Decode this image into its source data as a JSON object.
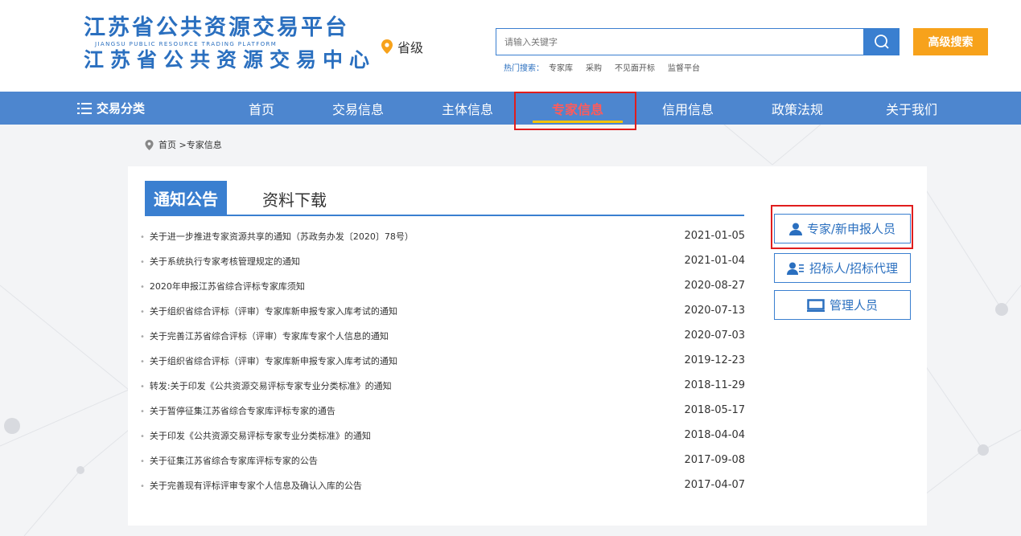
{
  "header": {
    "logo_line1": "江苏省公共资源交易平台",
    "logo_sub": "JIANGSU PUBLIC RESOURCE TRADING PLATFORM",
    "logo_line2": "江苏省公共资源交易中心",
    "region": "省级",
    "search": {
      "placeholder": "请输入关键字"
    },
    "advanced_search": "高级搜索",
    "hot_label": "热门搜索：",
    "hot_items": [
      "专家库",
      "采购",
      "不见面开标",
      "监督平台"
    ]
  },
  "nav": {
    "category": "交易分类",
    "items": [
      "首页",
      "交易信息",
      "主体信息",
      "专家信息",
      "信用信息",
      "政策法规",
      "关于我们"
    ],
    "active_index": 3
  },
  "breadcrumb": "首页 >专家信息",
  "tabs": {
    "active": "通知公告",
    "other": "资料下载"
  },
  "notices": [
    {
      "title": "关于进一步推进专家资源共享的通知（苏政务办发〔2020〕78号）",
      "date": "2021-01-05"
    },
    {
      "title": "关于系统执行专家考核管理规定的通知",
      "date": "2021-01-04"
    },
    {
      "title": "2020年申报江苏省综合评标专家库须知",
      "date": "2020-08-27"
    },
    {
      "title": "关于组织省综合评标（评审）专家库新申报专家入库考试的通知",
      "date": "2020-07-13"
    },
    {
      "title": "关于完善江苏省综合评标（评审）专家库专家个人信息的通知",
      "date": "2020-07-03"
    },
    {
      "title": "关于组织省综合评标（评审）专家库新申报专家入库考试的通知",
      "date": "2019-12-23"
    },
    {
      "title": "转发:关于印发《公共资源交易评标专家专业分类标准》的通知",
      "date": "2018-11-29"
    },
    {
      "title": "关于暂停征集江苏省综合专家库评标专家的通告",
      "date": "2018-05-17"
    },
    {
      "title": "关于印发《公共资源交易评标专家专业分类标准》的通知",
      "date": "2018-04-04"
    },
    {
      "title": "关于征集江苏省综合专家库评标专家的公告",
      "date": "2017-09-08"
    },
    {
      "title": "关于完善现有评标评审专家个人信息及确认入库的公告",
      "date": "2017-04-07"
    }
  ],
  "side_buttons": {
    "expert": "专家/新申报人员",
    "tenderer": "招标人/招标代理",
    "admin": "管理人员"
  },
  "colors": {
    "brand_blue": "#3a7fd0",
    "nav_blue": "#4d86cf",
    "orange": "#f7a21b",
    "highlight_red": "#e01d1d"
  }
}
